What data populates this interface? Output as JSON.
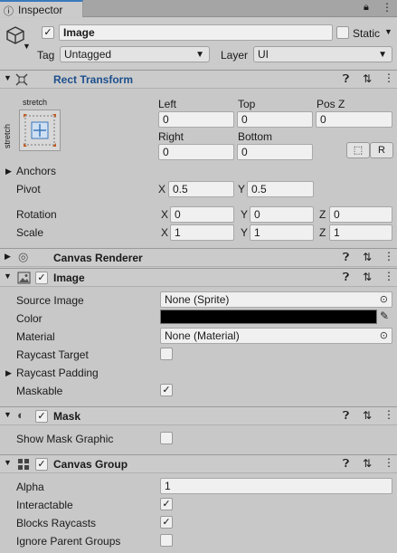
{
  "tab": {
    "title": "Inspector",
    "icons": [
      "lock-icon",
      "menu-icon"
    ]
  },
  "object": {
    "name": "Image",
    "active": true,
    "static_label": "Static",
    "tag_label": "Tag",
    "tag_value": "Untagged",
    "layer_label": "Layer",
    "layer_value": "UI"
  },
  "rect_transform": {
    "title": "Rect Transform",
    "anchor_preset_top": "stretch",
    "anchor_preset_side": "stretch",
    "left_label": "Left",
    "left_value": "0",
    "top_label": "Top",
    "top_value": "0",
    "posz_label": "Pos Z",
    "posz_value": "0",
    "right_label": "Right",
    "right_value": "0",
    "bottom_label": "Bottom",
    "bottom_value": "0",
    "raw_button": "R",
    "anchors_label": "Anchors",
    "pivot_label": "Pivot",
    "pivot_x": "0.5",
    "pivot_y": "0.5",
    "rotation_label": "Rotation",
    "rotation_x": "0",
    "rotation_y": "0",
    "rotation_z": "0",
    "scale_label": "Scale",
    "scale_x": "1",
    "scale_y": "1",
    "scale_z": "1",
    "x_label": "X",
    "y_label": "Y",
    "z_label": "Z"
  },
  "canvas_renderer": {
    "title": "Canvas Renderer"
  },
  "image": {
    "title": "Image",
    "source_image_label": "Source Image",
    "source_image_value": "None (Sprite)",
    "color_label": "Color",
    "color_value": "#000000",
    "material_label": "Material",
    "material_value": "None (Material)",
    "raycast_target_label": "Raycast Target",
    "raycast_target": false,
    "raycast_padding_label": "Raycast Padding",
    "maskable_label": "Maskable",
    "maskable": true
  },
  "mask": {
    "title": "Mask",
    "show_mask_graphic_label": "Show Mask Graphic",
    "show_mask_graphic": false
  },
  "canvas_group": {
    "title": "Canvas Group",
    "alpha_label": "Alpha",
    "alpha_value": "1",
    "interactable_label": "Interactable",
    "interactable": true,
    "blocks_raycasts_label": "Blocks Raycasts",
    "blocks_raycasts": true,
    "ignore_parent_groups_label": "Ignore Parent Groups",
    "ignore_parent_groups": false
  },
  "colors": {
    "accent": "#3a79bb",
    "rect_title": "#1d4f8c",
    "panel": "#c8c8c8",
    "field": "#f0f0f0"
  }
}
